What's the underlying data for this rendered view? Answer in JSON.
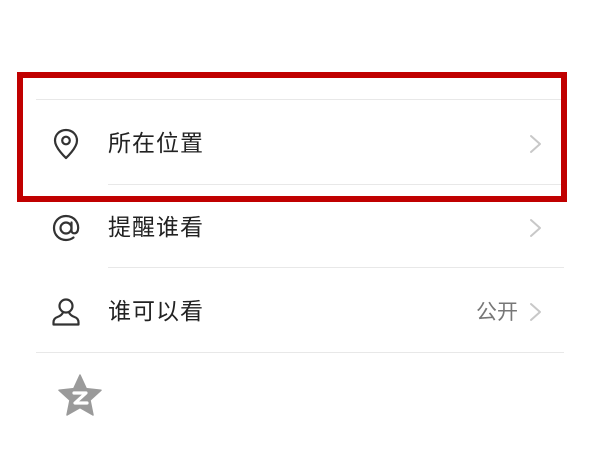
{
  "settings": {
    "items": [
      {
        "label": "所在位置",
        "value": "",
        "icon": "location-pin-icon"
      },
      {
        "label": "提醒谁看",
        "value": "",
        "icon": "at-sign-icon"
      },
      {
        "label": "谁可以看",
        "value": "公开",
        "icon": "person-icon"
      }
    ],
    "share_icon": "qzone-star-icon"
  },
  "annotation": {
    "highlight_color": "#c00000"
  },
  "colors": {
    "text": "#222222",
    "secondary_text": "#777777",
    "divider": "#e8e8e8",
    "icon_gray": "#9a9a9a"
  }
}
